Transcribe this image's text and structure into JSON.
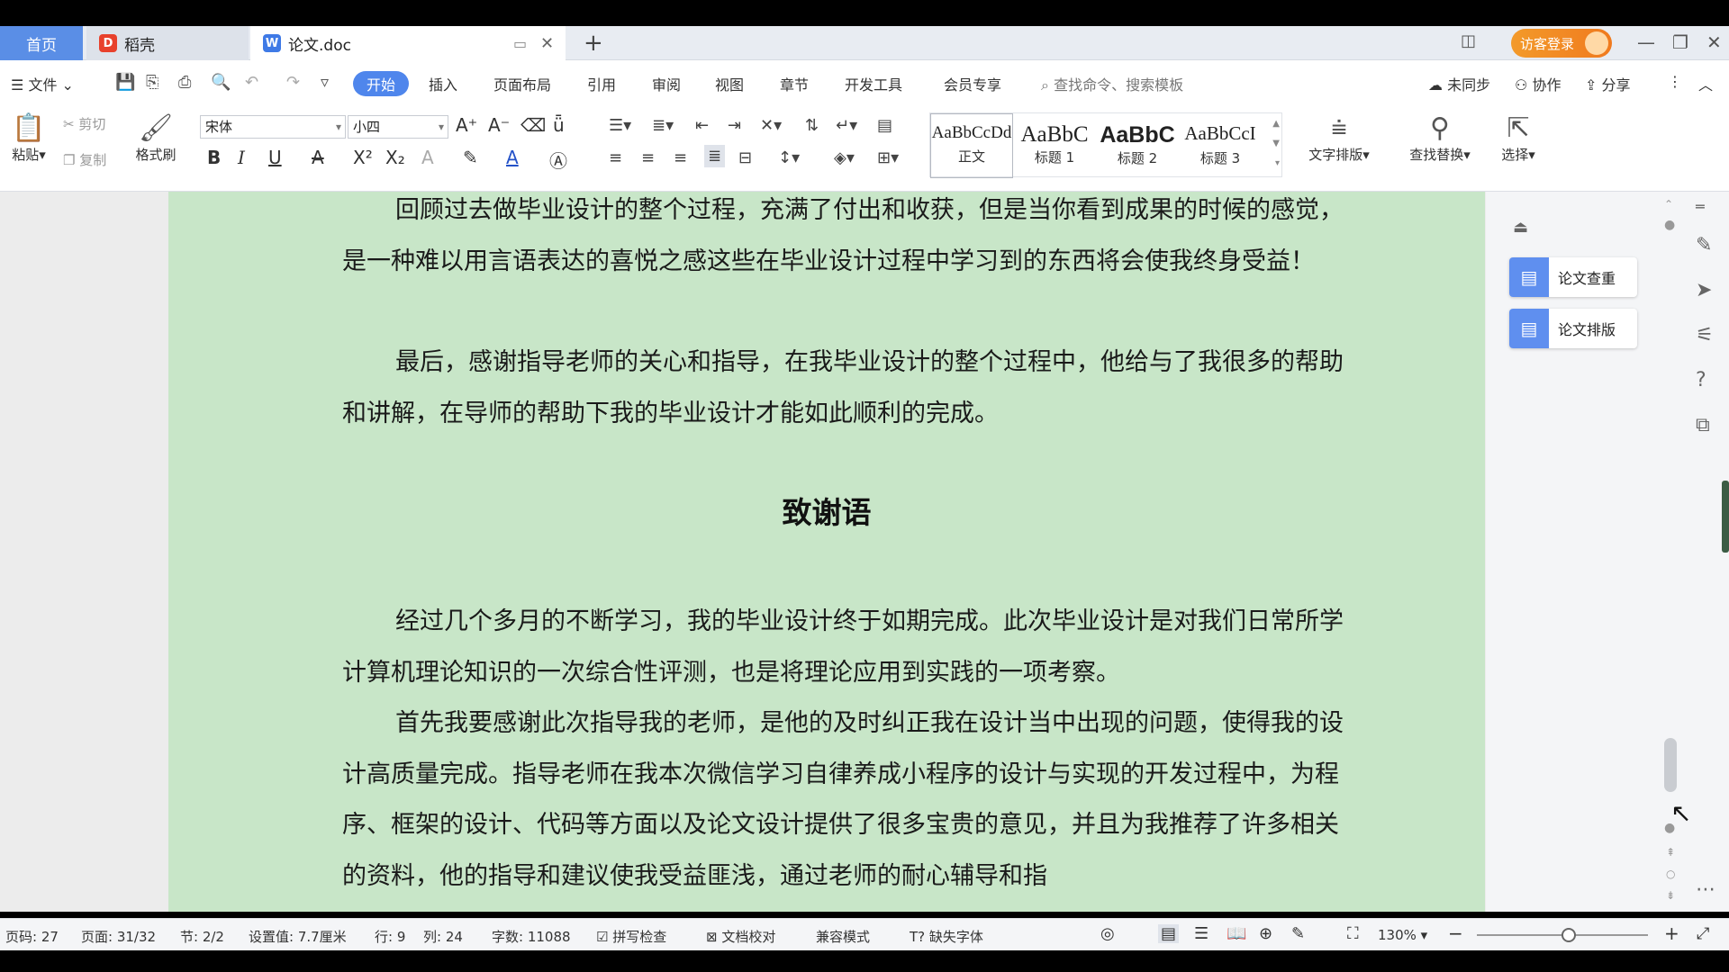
{
  "tabs": {
    "home": "首页",
    "daoke": "稻壳",
    "doc": "论文.doc",
    "login": "访客登录"
  },
  "menu": {
    "file": "文件",
    "start": "开始",
    "insert": "插入",
    "layout": "页面布局",
    "reference": "引用",
    "review": "审阅",
    "view": "视图",
    "chapter": "章节",
    "devtools": "开发工具",
    "member": "会员专享",
    "search_placeholder": "查找命令、搜索模板",
    "unsync": "未同步",
    "collab": "协作",
    "share": "分享"
  },
  "ribbon": {
    "paste": "粘贴",
    "cut": "剪切",
    "copy": "复制",
    "format_painter": "格式刷",
    "font_name": "宋体",
    "font_size": "小四",
    "styles": [
      {
        "preview": "AaBbCcDd",
        "name": "正文"
      },
      {
        "preview": "AaBbC",
        "name": "标题 1"
      },
      {
        "preview": "AaBbC",
        "name": "标题 2"
      },
      {
        "preview": "AaBbCcI",
        "name": "标题 3"
      }
    ],
    "text_layout": "文字排版",
    "find_replace": "查找替换",
    "select": "选择"
  },
  "document": {
    "paragraphs": [
      "回顾过去做毕业设计的整个过程，充满了付出和收获，但是当你看到成果的时候的感觉，是一种难以用言语表达的喜悦之感这些在毕业设计过程中学习到的东西将会使我终身受益！",
      "最后，感谢指导老师的关心和指导，在我毕业设计的整个过程中，他给与了我很多的帮助和讲解，在导师的帮助下我的毕业设计才能如此顺利的完成。",
      "经过几个多月的不断学习，我的毕业设计终于如期完成。此次毕业设计是对我们日常所学计算机理论知识的一次综合性评测，也是将理论应用到实践的一项考察。",
      "首先我要感谢此次指导我的老师，是他的及时纠正我在设计当中出现的问题，使得我的设计高质量完成。指导老师在我本次微信学习自律养成小程序的设计与实现的开发过程中，为程序、框架的设计、代码等方面以及论文设计提供了很多宝贵的意见，并且为我推荐了许多相关的资料，他的指导和建议使我受益匪浅，通过老师的耐心辅导和指"
    ],
    "heading": "致谢语"
  },
  "side_panel": {
    "check": "论文查重",
    "format": "论文排版"
  },
  "status": {
    "page_code": "页码: 27",
    "page": "页面: 31/32",
    "section": "节: 2/2",
    "setting": "设置值: 7.7厘米",
    "row": "行: 9",
    "col": "列: 24",
    "words": "字数: 11088",
    "spell": "拼写检查",
    "proof": "文档校对",
    "compat": "兼容模式",
    "missing_font": "缺失字体",
    "zoom": "130%"
  }
}
